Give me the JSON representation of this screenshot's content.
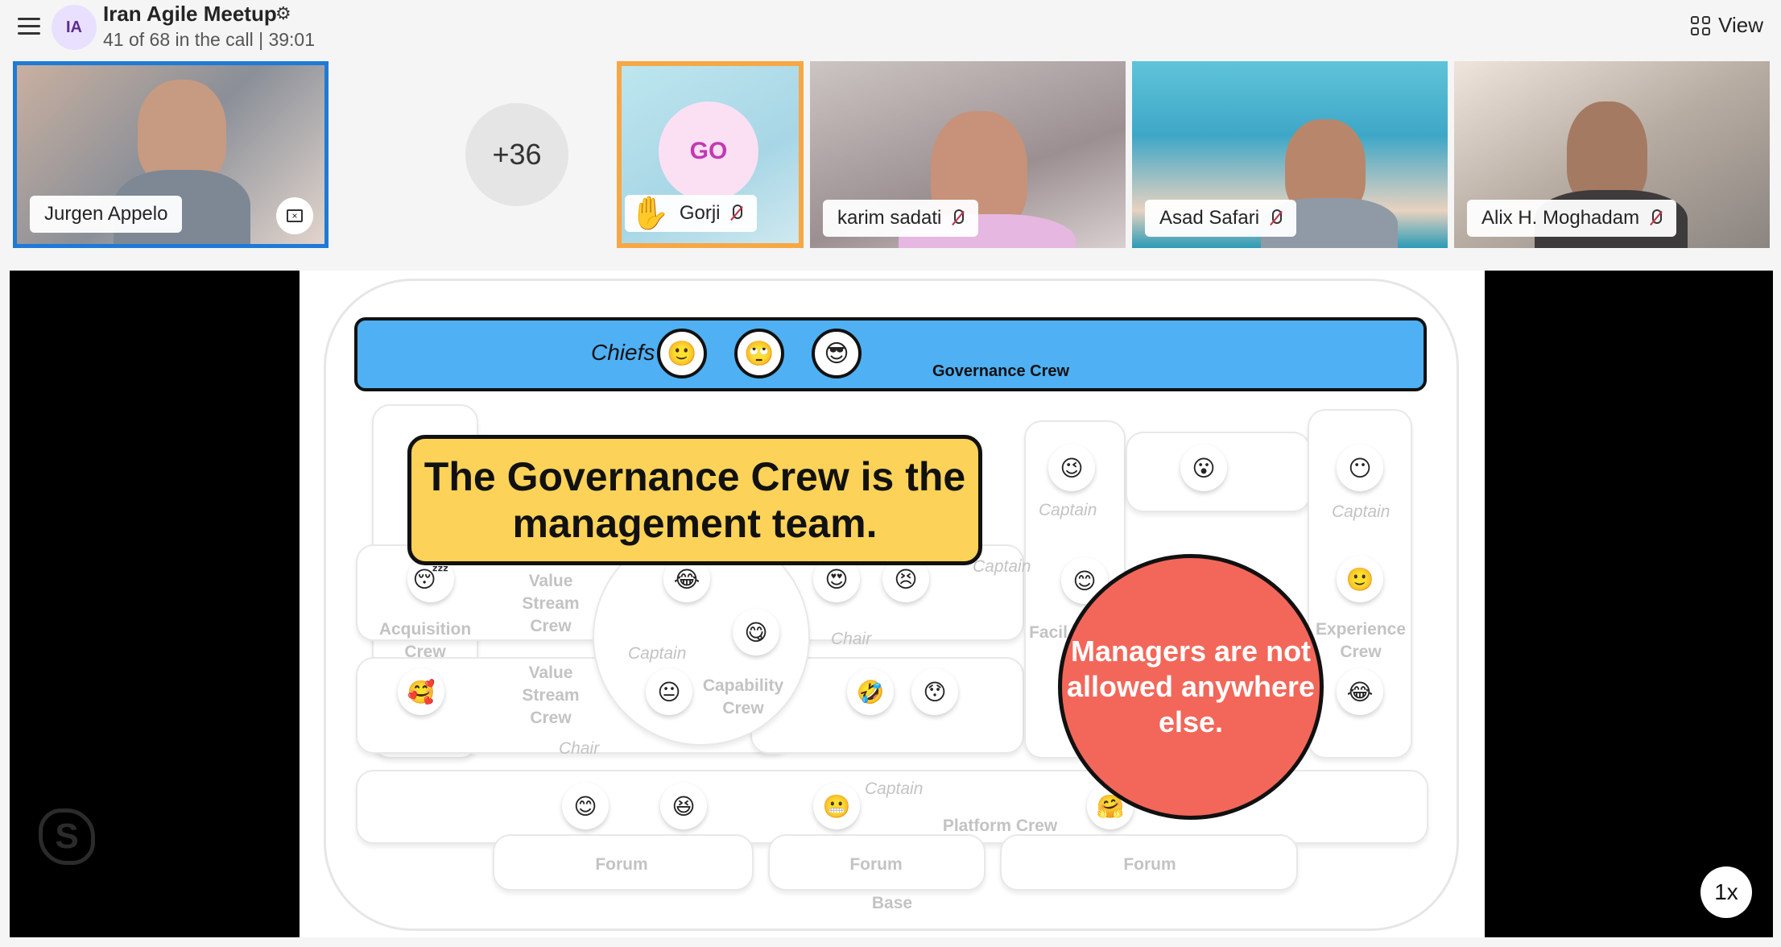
{
  "meeting": {
    "initials": "IA",
    "title": "Iran Agile Meetup",
    "subtitle": "41 of 68 in the call | 39:01",
    "view_label": "View"
  },
  "participants": [
    {
      "name": "Jurgen Appelo"
    },
    {
      "name": "Gorji",
      "initials": "GO",
      "hand_raised": true
    },
    {
      "name": "karim sadati"
    },
    {
      "name": "Asad Safari"
    },
    {
      "name": "Alix H. Moghadam"
    }
  ],
  "overflow_count": "+36",
  "slide": {
    "chiefs_label": "Chiefs",
    "governance_crew": "Governance Crew",
    "callout": "The Governance Crew is the management team.",
    "red_circle": "Managers are not allowed anywhere else.",
    "labels": {
      "value_stream_1": "Value Stream Crew",
      "value_stream_2": "Value Stream Crew",
      "acquisition": "Acquisition Crew",
      "capability": "Capability Crew",
      "experience": "Experience Crew",
      "platform": "Platform Crew",
      "forum": "Forum",
      "base": "Base",
      "captain": "Captain",
      "chair": "Chair",
      "facil": "Facil"
    },
    "chief_emojis": [
      "🙂",
      "🙄",
      "😎"
    ]
  },
  "playback_speed": "1x",
  "colors": {
    "accent_blue": "#1e7ad6",
    "hand_orange": "#f7a744",
    "chiefs_blue": "#4fb0f4",
    "callout_yellow": "#fcd258",
    "red": "#f2675a"
  }
}
